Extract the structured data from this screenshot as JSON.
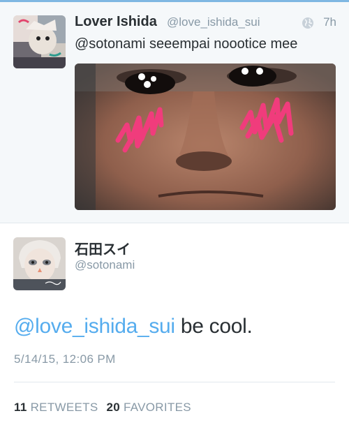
{
  "tweet": {
    "display_name": "Lover Ishida",
    "handle": "@love_ishida_sui",
    "timestamp": "7h",
    "text": "@sotonami seeempai noootice mee",
    "icons": {
      "location": "globe-icon"
    }
  },
  "reply": {
    "display_name": "石田スイ",
    "handle": "@sotonami",
    "mention": "@love_ishida_sui",
    "text": " be cool.",
    "date": "5/14/15, 12:06 PM",
    "retweets_count": "11",
    "retweets_label": "RETWEETS",
    "favorites_count": "20",
    "favorites_label": "FAVORITES"
  },
  "colors": {
    "link": "#55acee",
    "text": "#292f33",
    "muted": "#8899a6",
    "highlight_bg": "#f5f8fa"
  }
}
